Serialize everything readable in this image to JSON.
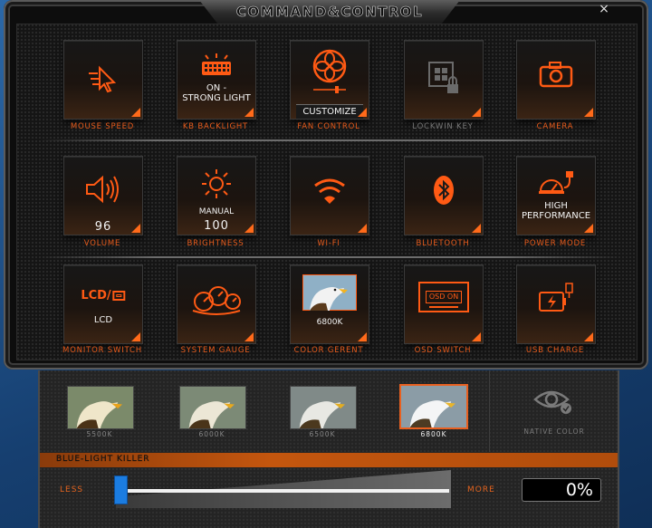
{
  "window": {
    "title": "COMMAND&CONTROL",
    "close_label": "×"
  },
  "tiles": [
    {
      "id": "mouse-speed",
      "label": "MOUSE SPEED",
      "value": "",
      "icon": "cursor-speed-icon",
      "enabled": true
    },
    {
      "id": "kb-backlight",
      "label": "KB BACKLIGHT",
      "value": "ON -\nSTRONG LIGHT",
      "icon": "keyboard-backlight-icon",
      "enabled": true
    },
    {
      "id": "fan-control",
      "label": "FAN CONTROL",
      "value": "CUSTOMIZE",
      "icon": "fan-icon",
      "enabled": true
    },
    {
      "id": "lockwin-key",
      "label": "LOCKWIN KEY",
      "value": "",
      "icon": "windows-lock-icon",
      "enabled": false
    },
    {
      "id": "camera",
      "label": "CAMERA",
      "value": "",
      "icon": "camera-icon",
      "enabled": true
    },
    {
      "id": "volume",
      "label": "VOLUME",
      "value": "96",
      "icon": "speaker-icon",
      "enabled": true
    },
    {
      "id": "brightness",
      "label": "BRIGHTNESS",
      "value_top": "MANUAL",
      "value": "100",
      "icon": "sun-icon",
      "enabled": true
    },
    {
      "id": "wifi",
      "label": "WI-FI",
      "value": "",
      "icon": "wifi-icon",
      "enabled": true
    },
    {
      "id": "bluetooth",
      "label": "BLUETOOTH",
      "value": "",
      "icon": "bluetooth-icon",
      "enabled": true
    },
    {
      "id": "power-mode",
      "label": "POWER MODE",
      "value": "HIGH\nPERFORMANCE",
      "icon": "power-plug-icon",
      "enabled": true
    },
    {
      "id": "monitor-switch",
      "label": "MONITOR SWITCH",
      "value": "LCD",
      "icon_text": "LCD/",
      "icon": "monitor-icon",
      "enabled": true
    },
    {
      "id": "system-gauge",
      "label": "SYSTEM GAUGE",
      "value": "",
      "icon": "gauge-icon",
      "enabled": true
    },
    {
      "id": "color-gerent",
      "label": "COLOR GERENT",
      "value": "6800K",
      "icon": "eagle-thumbnail-icon",
      "enabled": true
    },
    {
      "id": "osd-switch",
      "label": "OSD SWITCH",
      "value": "",
      "icon_text": "OSD ON",
      "icon": "osd-icon",
      "enabled": true
    },
    {
      "id": "usb-charge",
      "label": "USB CHARGE",
      "value": "",
      "icon": "usb-battery-icon",
      "enabled": true
    }
  ],
  "color_temps": [
    {
      "label": "5500K",
      "selected": false
    },
    {
      "label": "6000K",
      "selected": false
    },
    {
      "label": "6500K",
      "selected": false
    },
    {
      "label": "6800K",
      "selected": true
    }
  ],
  "native_color": {
    "label": "NATIVE COLOR"
  },
  "blue_light": {
    "title": "BLUE-LIGHT KILLER",
    "less_label": "LESS",
    "more_label": "MORE",
    "value": 0,
    "value_text": "0%"
  },
  "colors": {
    "accent": "#ff6a1a",
    "label": "#e85b1b",
    "slider": "#1b7ce0"
  }
}
